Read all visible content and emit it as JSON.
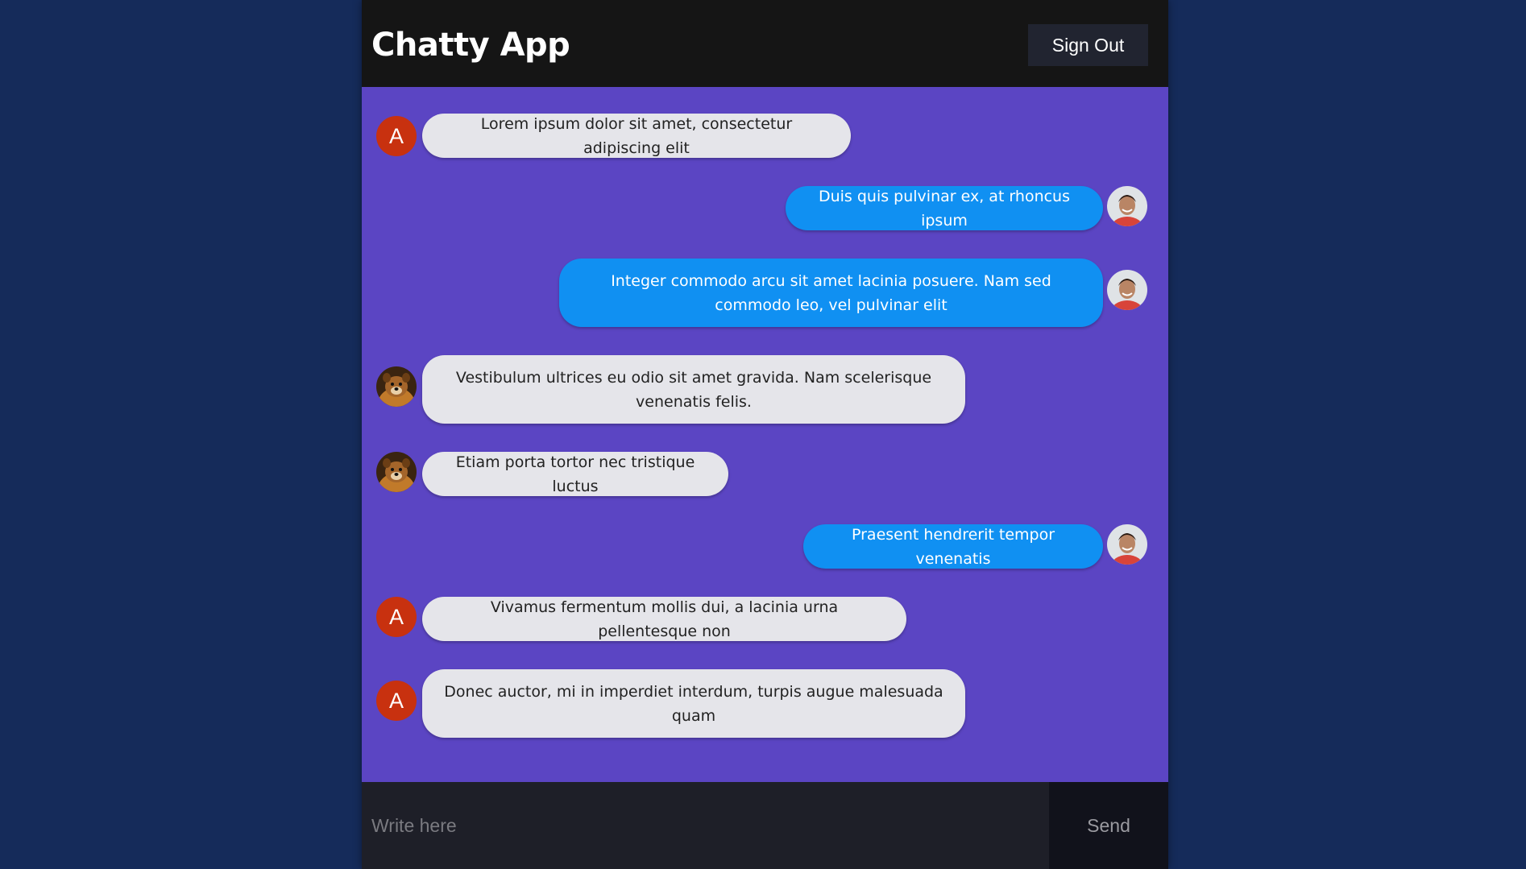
{
  "header": {
    "title": "Chatty App",
    "sign_out_label": "Sign Out"
  },
  "messages": [
    {
      "sender": "other",
      "avatar": "letter",
      "avatar_letter": "A",
      "text": "Lorem ipsum dolor sit amet, consectetur adipiscing elit"
    },
    {
      "sender": "self",
      "avatar": "user-photo",
      "text": "Duis quis pulvinar ex, at rhoncus ipsum"
    },
    {
      "sender": "self",
      "avatar": "user-photo",
      "text": "Integer commodo arcu sit amet lacinia posuere. Nam sed commodo leo, vel pulvinar elit"
    },
    {
      "sender": "other",
      "avatar": "dog-photo",
      "text": "Vestibulum ultrices eu odio sit amet gravida. Nam scelerisque venenatis felis."
    },
    {
      "sender": "other",
      "avatar": "dog-photo",
      "text": "Etiam porta tortor nec tristique luctus"
    },
    {
      "sender": "self",
      "avatar": "user-photo",
      "text": "Praesent hendrerit tempor venenatis"
    },
    {
      "sender": "other",
      "avatar": "letter",
      "avatar_letter": "A",
      "text": "Vivamus fermentum mollis dui, a lacinia urna pellentesque non"
    },
    {
      "sender": "other",
      "avatar": "letter",
      "avatar_letter": "A",
      "text": "Donec auctor, mi in imperdiet interdum, turpis augue malesuada quam"
    }
  ],
  "composer": {
    "input_value": "",
    "placeholder": "Write here",
    "send_label": "Send"
  },
  "colors": {
    "page_background": "#152b5a",
    "chat_background": "#5b45c3",
    "header_background": "#151515",
    "sent_bubble": "#1090f2",
    "received_bubble": "#e5e5ea",
    "letter_avatar": "#c8310f"
  }
}
